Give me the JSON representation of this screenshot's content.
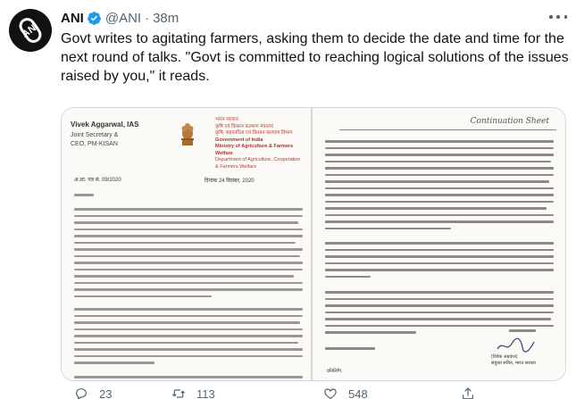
{
  "account": {
    "name": "ANI",
    "handle": "@ANI",
    "separator": "·",
    "time": "38m",
    "avatar_text": "ANI"
  },
  "tweet": {
    "text": "Govt writes to agitating farmers, asking them to decide the date and time for the next round of talks. \"Govt is committed to reaching logical solutions of the issues raised by you,\" it reads."
  },
  "letter": {
    "sender_name": "Vivek Aggarwal, IAS",
    "sender_title_1": "Joint Secretary &",
    "sender_title_2": "CEO, PM-KISAN",
    "ministry_hi_1": "भारत सरकार",
    "ministry_hi_2": "कृषि एवं किसान कल्याण मंत्रालय",
    "ministry_hi_3": "कृषि, सहकारिता एवं किसान कल्याण विभाग",
    "ministry_en_1": "Government of India",
    "ministry_en_2": "Ministry of Agriculture & Farmers Welfare",
    "ministry_en_3": "Department of Agriculture, Cooperation",
    "ministry_en_4": "& Farmers Welfare",
    "ref_no": "अ.शा. पत्र सं. 09/2020",
    "date": "दिनांक 24 दिसंबर, 2020",
    "continuation": "Continuation Sheet",
    "sign_name": "(विवेक अग्रवाल)",
    "sign_title": "संयुक्त सचिव, भारत सरकार",
    "cc": "प्रतिलिपि:"
  },
  "actions": {
    "replies": "23",
    "retweets": "113",
    "likes": "548"
  },
  "colors": {
    "text_primary": "#0f1419",
    "text_secondary": "#536471",
    "verified": "#1d9bf0",
    "border": "#cfd9de",
    "letterhead_red": "#c23a2b"
  }
}
